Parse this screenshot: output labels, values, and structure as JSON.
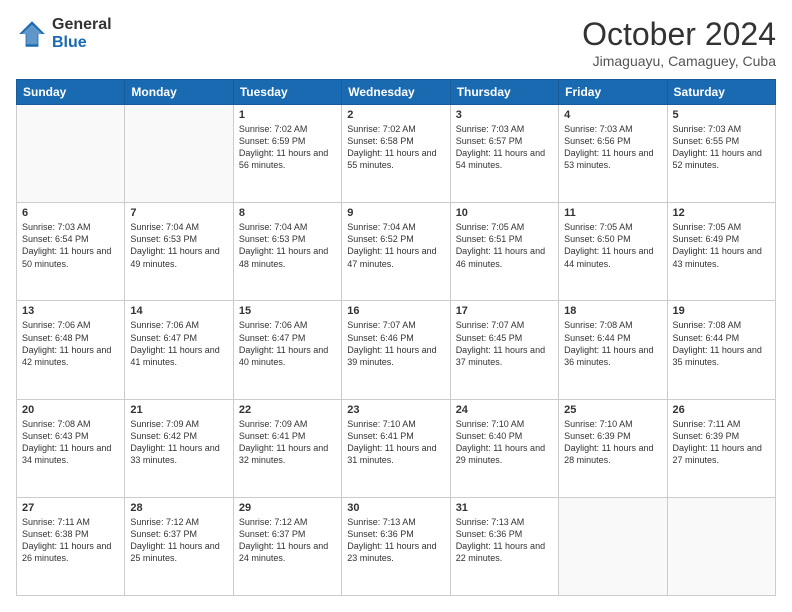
{
  "logo": {
    "general": "General",
    "blue": "Blue"
  },
  "title": "October 2024",
  "location": "Jimaguayu, Camaguey, Cuba",
  "days_header": [
    "Sunday",
    "Monday",
    "Tuesday",
    "Wednesday",
    "Thursday",
    "Friday",
    "Saturday"
  ],
  "weeks": [
    [
      {
        "day": "",
        "sunrise": "",
        "sunset": "",
        "daylight": ""
      },
      {
        "day": "",
        "sunrise": "",
        "sunset": "",
        "daylight": ""
      },
      {
        "day": "1",
        "sunrise": "Sunrise: 7:02 AM",
        "sunset": "Sunset: 6:59 PM",
        "daylight": "Daylight: 11 hours and 56 minutes."
      },
      {
        "day": "2",
        "sunrise": "Sunrise: 7:02 AM",
        "sunset": "Sunset: 6:58 PM",
        "daylight": "Daylight: 11 hours and 55 minutes."
      },
      {
        "day": "3",
        "sunrise": "Sunrise: 7:03 AM",
        "sunset": "Sunset: 6:57 PM",
        "daylight": "Daylight: 11 hours and 54 minutes."
      },
      {
        "day": "4",
        "sunrise": "Sunrise: 7:03 AM",
        "sunset": "Sunset: 6:56 PM",
        "daylight": "Daylight: 11 hours and 53 minutes."
      },
      {
        "day": "5",
        "sunrise": "Sunrise: 7:03 AM",
        "sunset": "Sunset: 6:55 PM",
        "daylight": "Daylight: 11 hours and 52 minutes."
      }
    ],
    [
      {
        "day": "6",
        "sunrise": "Sunrise: 7:03 AM",
        "sunset": "Sunset: 6:54 PM",
        "daylight": "Daylight: 11 hours and 50 minutes."
      },
      {
        "day": "7",
        "sunrise": "Sunrise: 7:04 AM",
        "sunset": "Sunset: 6:53 PM",
        "daylight": "Daylight: 11 hours and 49 minutes."
      },
      {
        "day": "8",
        "sunrise": "Sunrise: 7:04 AM",
        "sunset": "Sunset: 6:53 PM",
        "daylight": "Daylight: 11 hours and 48 minutes."
      },
      {
        "day": "9",
        "sunrise": "Sunrise: 7:04 AM",
        "sunset": "Sunset: 6:52 PM",
        "daylight": "Daylight: 11 hours and 47 minutes."
      },
      {
        "day": "10",
        "sunrise": "Sunrise: 7:05 AM",
        "sunset": "Sunset: 6:51 PM",
        "daylight": "Daylight: 11 hours and 46 minutes."
      },
      {
        "day": "11",
        "sunrise": "Sunrise: 7:05 AM",
        "sunset": "Sunset: 6:50 PM",
        "daylight": "Daylight: 11 hours and 44 minutes."
      },
      {
        "day": "12",
        "sunrise": "Sunrise: 7:05 AM",
        "sunset": "Sunset: 6:49 PM",
        "daylight": "Daylight: 11 hours and 43 minutes."
      }
    ],
    [
      {
        "day": "13",
        "sunrise": "Sunrise: 7:06 AM",
        "sunset": "Sunset: 6:48 PM",
        "daylight": "Daylight: 11 hours and 42 minutes."
      },
      {
        "day": "14",
        "sunrise": "Sunrise: 7:06 AM",
        "sunset": "Sunset: 6:47 PM",
        "daylight": "Daylight: 11 hours and 41 minutes."
      },
      {
        "day": "15",
        "sunrise": "Sunrise: 7:06 AM",
        "sunset": "Sunset: 6:47 PM",
        "daylight": "Daylight: 11 hours and 40 minutes."
      },
      {
        "day": "16",
        "sunrise": "Sunrise: 7:07 AM",
        "sunset": "Sunset: 6:46 PM",
        "daylight": "Daylight: 11 hours and 39 minutes."
      },
      {
        "day": "17",
        "sunrise": "Sunrise: 7:07 AM",
        "sunset": "Sunset: 6:45 PM",
        "daylight": "Daylight: 11 hours and 37 minutes."
      },
      {
        "day": "18",
        "sunrise": "Sunrise: 7:08 AM",
        "sunset": "Sunset: 6:44 PM",
        "daylight": "Daylight: 11 hours and 36 minutes."
      },
      {
        "day": "19",
        "sunrise": "Sunrise: 7:08 AM",
        "sunset": "Sunset: 6:44 PM",
        "daylight": "Daylight: 11 hours and 35 minutes."
      }
    ],
    [
      {
        "day": "20",
        "sunrise": "Sunrise: 7:08 AM",
        "sunset": "Sunset: 6:43 PM",
        "daylight": "Daylight: 11 hours and 34 minutes."
      },
      {
        "day": "21",
        "sunrise": "Sunrise: 7:09 AM",
        "sunset": "Sunset: 6:42 PM",
        "daylight": "Daylight: 11 hours and 33 minutes."
      },
      {
        "day": "22",
        "sunrise": "Sunrise: 7:09 AM",
        "sunset": "Sunset: 6:41 PM",
        "daylight": "Daylight: 11 hours and 32 minutes."
      },
      {
        "day": "23",
        "sunrise": "Sunrise: 7:10 AM",
        "sunset": "Sunset: 6:41 PM",
        "daylight": "Daylight: 11 hours and 31 minutes."
      },
      {
        "day": "24",
        "sunrise": "Sunrise: 7:10 AM",
        "sunset": "Sunset: 6:40 PM",
        "daylight": "Daylight: 11 hours and 29 minutes."
      },
      {
        "day": "25",
        "sunrise": "Sunrise: 7:10 AM",
        "sunset": "Sunset: 6:39 PM",
        "daylight": "Daylight: 11 hours and 28 minutes."
      },
      {
        "day": "26",
        "sunrise": "Sunrise: 7:11 AM",
        "sunset": "Sunset: 6:39 PM",
        "daylight": "Daylight: 11 hours and 27 minutes."
      }
    ],
    [
      {
        "day": "27",
        "sunrise": "Sunrise: 7:11 AM",
        "sunset": "Sunset: 6:38 PM",
        "daylight": "Daylight: 11 hours and 26 minutes."
      },
      {
        "day": "28",
        "sunrise": "Sunrise: 7:12 AM",
        "sunset": "Sunset: 6:37 PM",
        "daylight": "Daylight: 11 hours and 25 minutes."
      },
      {
        "day": "29",
        "sunrise": "Sunrise: 7:12 AM",
        "sunset": "Sunset: 6:37 PM",
        "daylight": "Daylight: 11 hours and 24 minutes."
      },
      {
        "day": "30",
        "sunrise": "Sunrise: 7:13 AM",
        "sunset": "Sunset: 6:36 PM",
        "daylight": "Daylight: 11 hours and 23 minutes."
      },
      {
        "day": "31",
        "sunrise": "Sunrise: 7:13 AM",
        "sunset": "Sunset: 6:36 PM",
        "daylight": "Daylight: 11 hours and 22 minutes."
      },
      {
        "day": "",
        "sunrise": "",
        "sunset": "",
        "daylight": ""
      },
      {
        "day": "",
        "sunrise": "",
        "sunset": "",
        "daylight": ""
      }
    ]
  ]
}
